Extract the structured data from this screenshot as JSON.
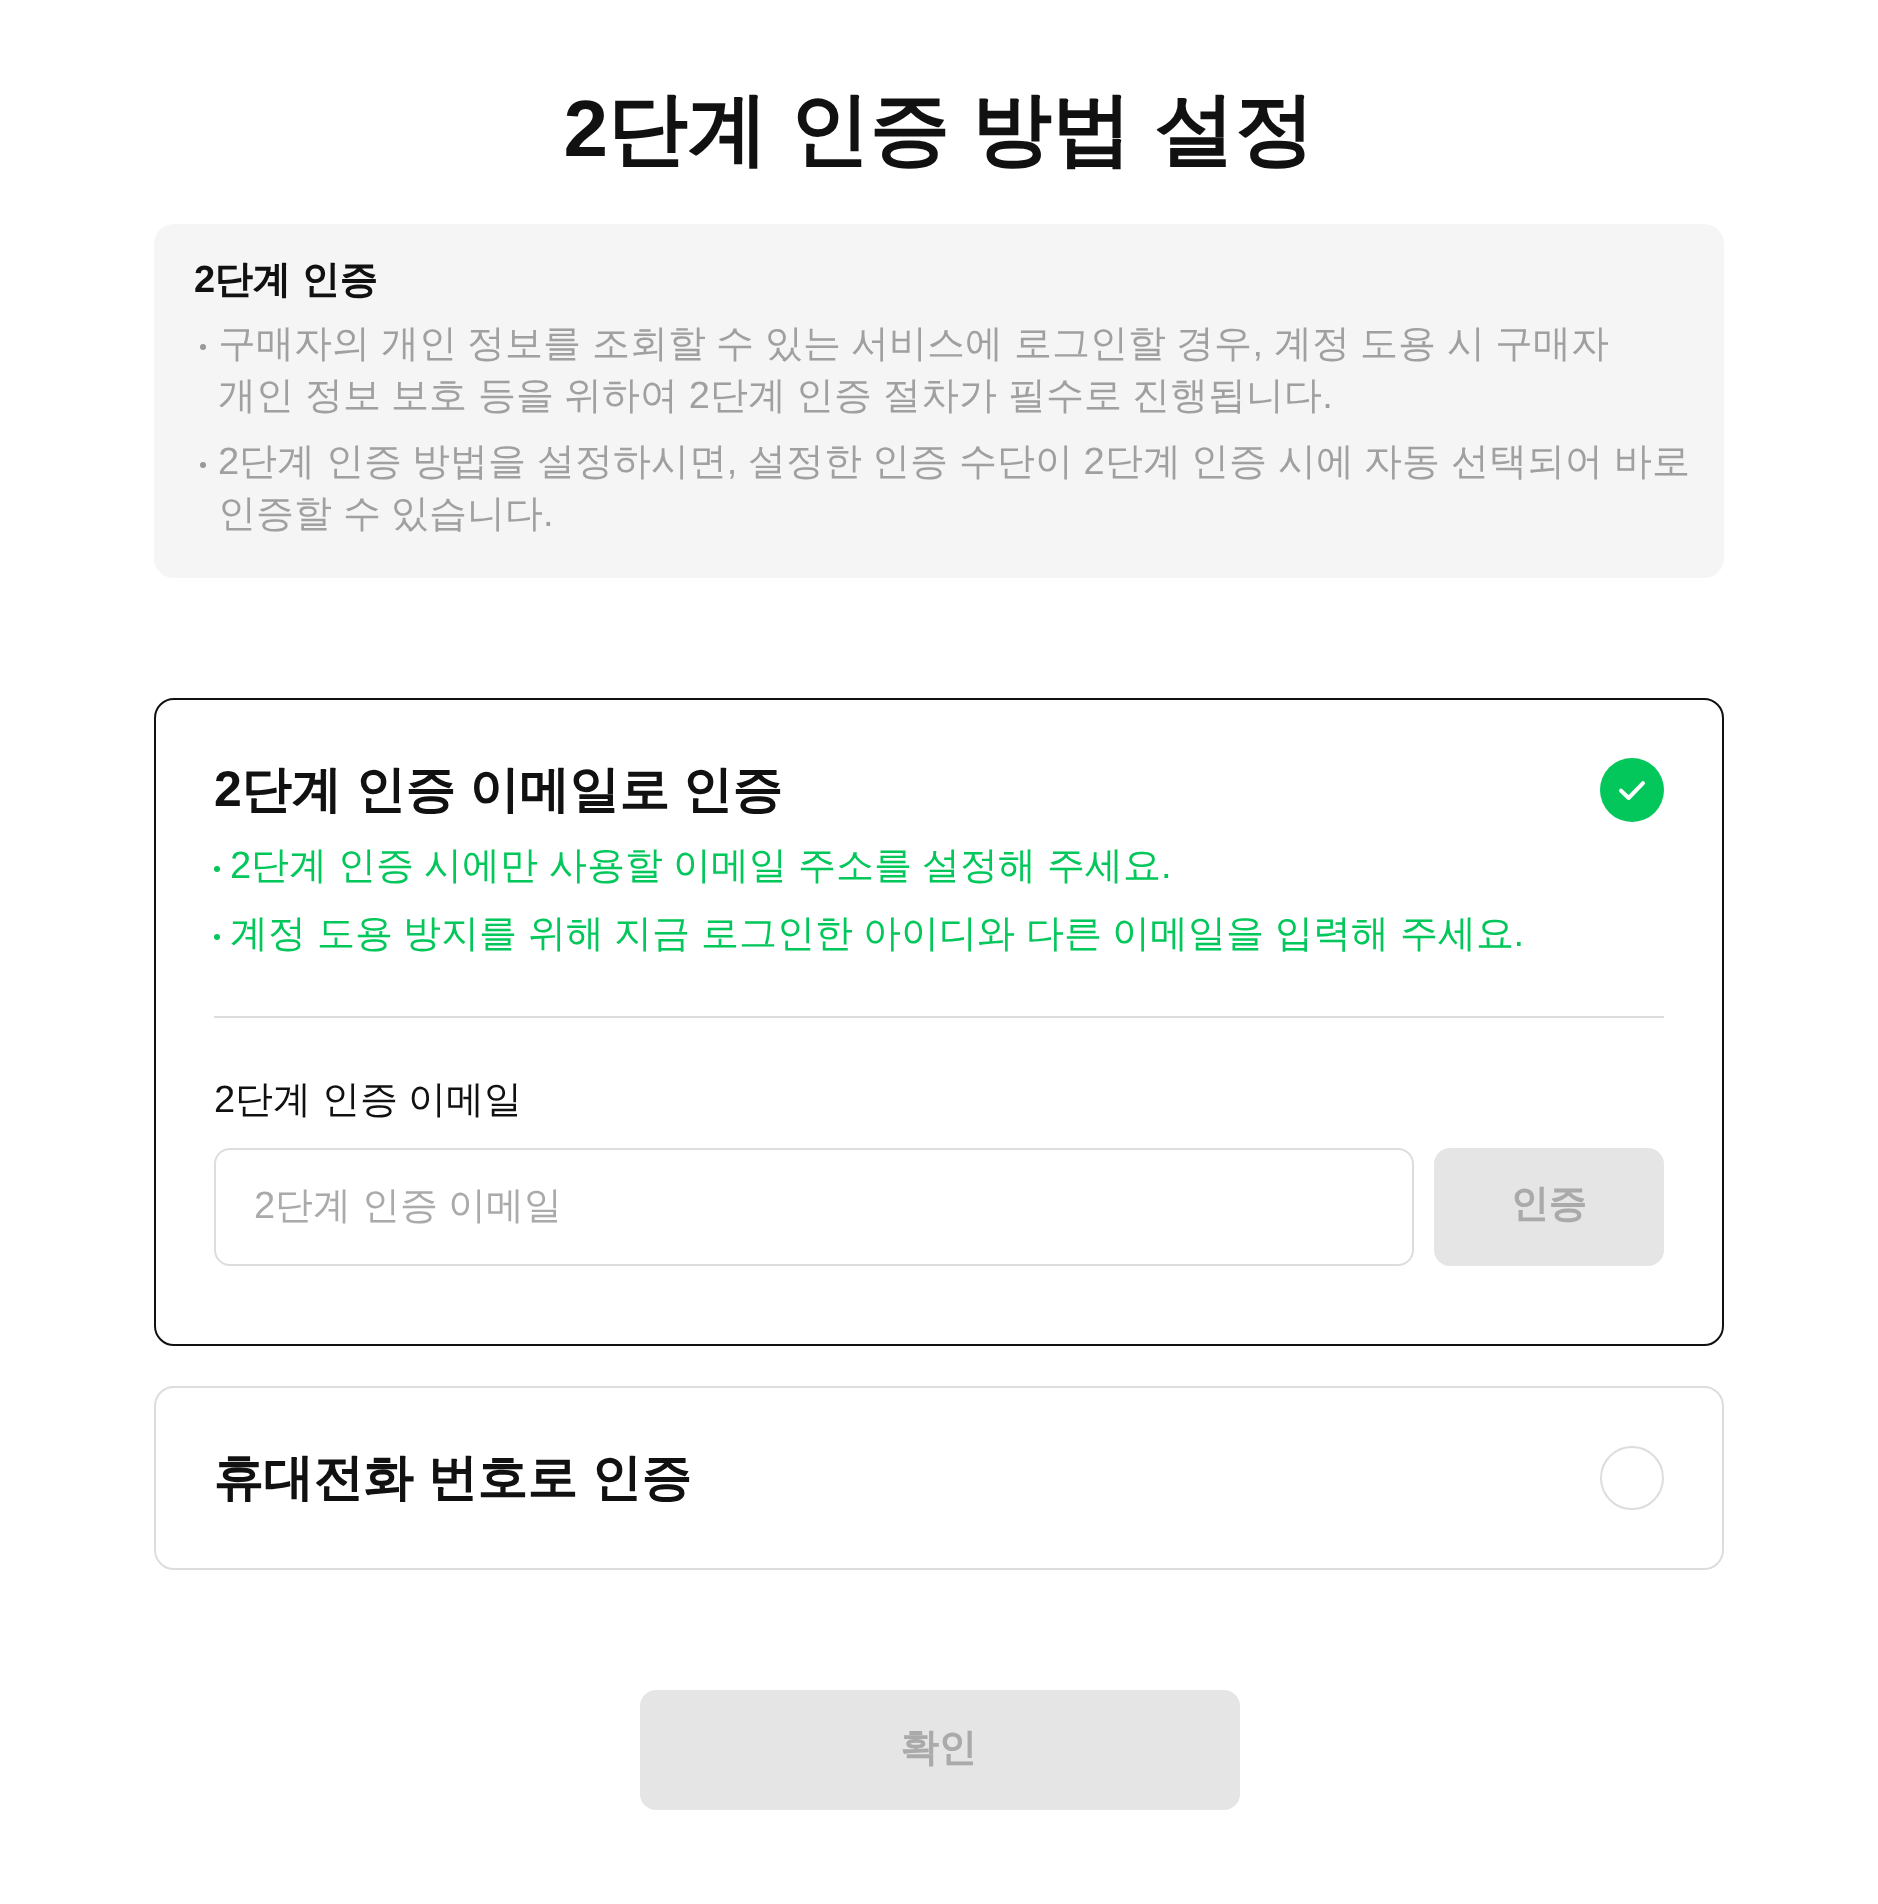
{
  "page": {
    "title": "2단계 인증 방법 설정"
  },
  "notice": {
    "heading": "2단계 인증",
    "items": [
      "구매자의 개인 정보를 조회할 수 있는 서비스에 로그인할 경우, 계정 도용 시 구매자 개인 정보 보호 등을 위하여 2단계 인증 절차가 필수로 진행됩니다.",
      "2단계 인증 방법을 설정하시면, 설정한 인증 수단이 2단계 인증 시에 자동 선택되어 바로 인증할 수 있습니다."
    ]
  },
  "methods": [
    {
      "title": "2단계 인증 이메일로 인증",
      "selected": true,
      "notes": [
        "2단계 인증 시에만 사용할 이메일 주소를 설정해 주세요.",
        "계정 도용 방지를 위해 지금 로그인한 아이디와 다른 이메일을 입력해 주세요."
      ],
      "field": {
        "label": "2단계 인증 이메일",
        "placeholder": "2단계 인증 이메일"
      },
      "button": {
        "label": "인증",
        "disabled": true
      }
    },
    {
      "title": "휴대전화 번호로 인증",
      "selected": false
    }
  ],
  "confirm_button": {
    "label": "확인",
    "disabled": true
  }
}
